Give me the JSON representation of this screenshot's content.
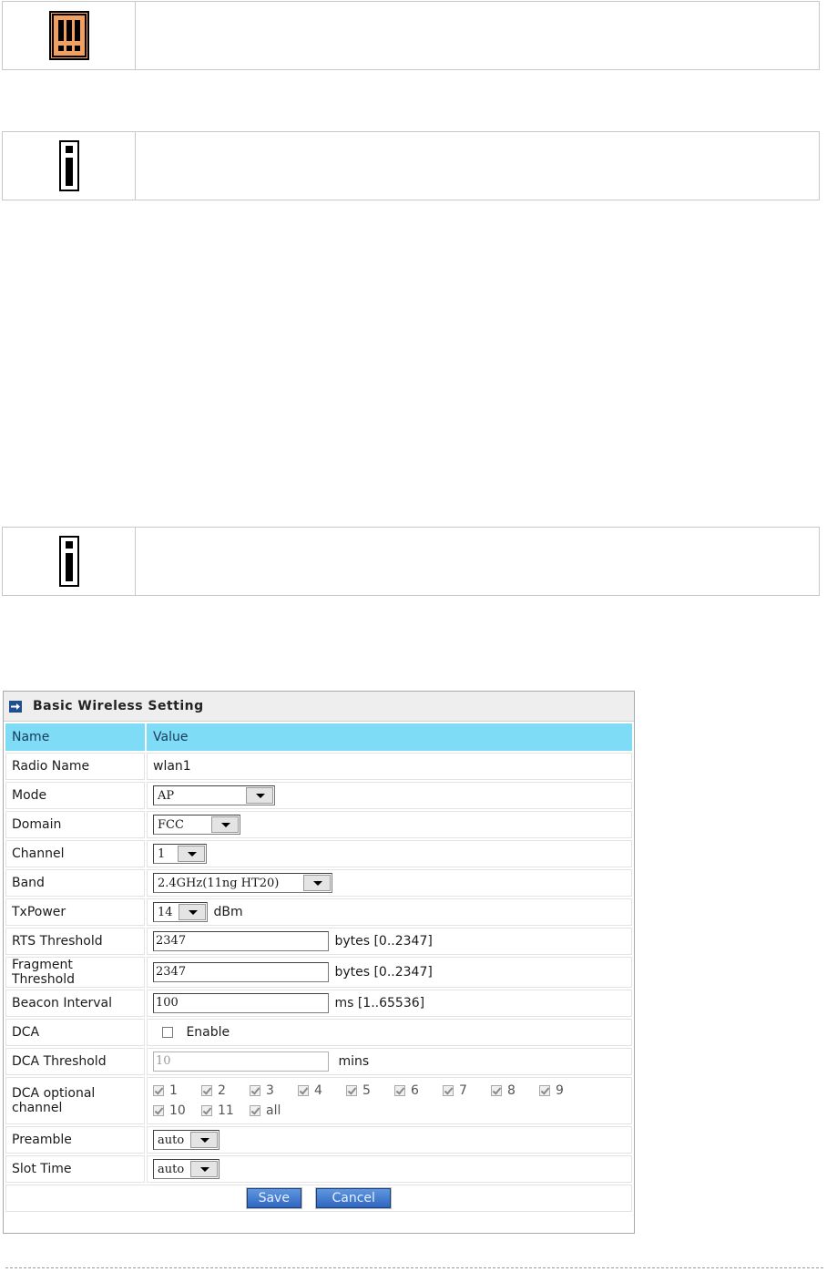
{
  "panel": {
    "title": "Basic Wireless Setting",
    "col_name": "Name",
    "col_value": "Value",
    "radio_name": {
      "label": "Radio Name",
      "value": "wlan1"
    },
    "mode": {
      "label": "Mode",
      "value": "AP"
    },
    "domain": {
      "label": "Domain",
      "value": "FCC"
    },
    "channel": {
      "label": "Channel",
      "value": "1"
    },
    "band": {
      "label": "Band",
      "value": "2.4GHz(11ng HT20)"
    },
    "txpower": {
      "label": "TxPower",
      "value": "14",
      "unit": "dBm"
    },
    "rts": {
      "label": "RTS Threshold",
      "value": "2347",
      "unit": "bytes [0..2347]"
    },
    "frag": {
      "label": "Fragment Threshold",
      "value": "2347",
      "unit": "bytes [0..2347]"
    },
    "beacon": {
      "label": "Beacon Interval",
      "value": "100",
      "unit": "ms [1..65536]"
    },
    "dca": {
      "label": "DCA",
      "checkbox_label": "Enable",
      "checked": false
    },
    "dca_threshold": {
      "label": "DCA Threshold",
      "value": "10",
      "unit": "mins"
    },
    "dca_channels": {
      "label": "DCA optional channel",
      "items": [
        "1",
        "2",
        "3",
        "4",
        "5",
        "6",
        "7",
        "8",
        "9",
        "10",
        "11",
        "all"
      ]
    },
    "preamble": {
      "label": "Preamble",
      "value": "auto"
    },
    "slot_time": {
      "label": "Slot Time",
      "value": "auto"
    },
    "save_label": "Save",
    "cancel_label": "Cancel"
  },
  "colors": {
    "header_row": "#7fdcf7",
    "warning_icon": "#f0a060",
    "button": "#2f66c0"
  },
  "icons": [
    "warning-icon",
    "info-icon",
    "info-icon",
    "arrow-right-icon"
  ]
}
